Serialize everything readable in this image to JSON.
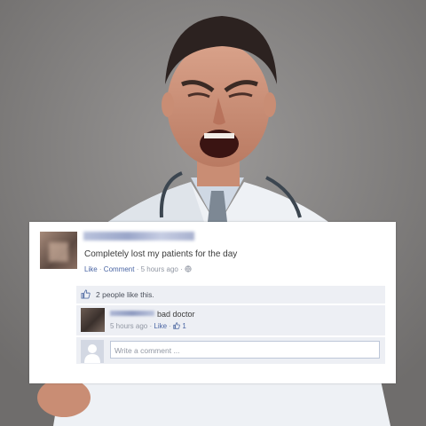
{
  "photo": {
    "subject": "angry-doctor-photo",
    "background_color": "#8a8887"
  },
  "post": {
    "text": "Completely lost my patients for the day",
    "like_label": "Like",
    "separator": " · ",
    "comment_label": "Comment",
    "timestamp": "5 hours ago",
    "audience_icon": "globe-icon"
  },
  "likes": {
    "text": "2 people like this."
  },
  "comment": {
    "text": "bad doctor",
    "timestamp": "5 hours ago",
    "like_label": "Like",
    "like_count": "1"
  },
  "composer": {
    "placeholder": "Write a comment ..."
  },
  "colors": {
    "link": "#4a65a4",
    "meta": "#9197a3",
    "panel": "#edeff4"
  }
}
